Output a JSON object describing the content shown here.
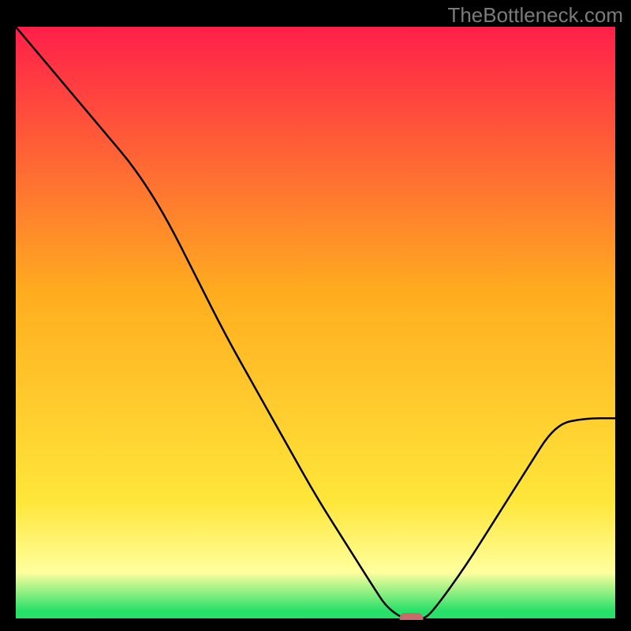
{
  "watermark": "TheBottleneck.com",
  "colors": {
    "black": "#000000",
    "red_top": "#ff1f4a",
    "orange_mid": "#ffad1f",
    "yellow": "#ffe63a",
    "pale_yellow": "#ffff9e",
    "green": "#27e06a",
    "curve": "#000000",
    "marker": "#c96a6a",
    "watermark": "#7b7b7b"
  },
  "chart_data": {
    "type": "line",
    "title": "",
    "xlabel": "",
    "ylabel": "",
    "xlim": [
      0,
      100
    ],
    "ylim": [
      0,
      100
    ],
    "x": [
      0,
      5,
      10,
      15,
      20,
      25,
      30,
      35,
      40,
      45,
      50,
      55,
      60,
      62,
      65,
      68,
      70,
      75,
      80,
      85,
      90,
      95,
      100
    ],
    "values": [
      100,
      94,
      88,
      82,
      76,
      68,
      58,
      48,
      39,
      30,
      21,
      13,
      5,
      2,
      0,
      0,
      2,
      9,
      17,
      25,
      33,
      34,
      34
    ],
    "marker": {
      "x": 66,
      "y": 0
    },
    "gradient_stops": [
      {
        "pos": 0.0,
        "color": "#ff1f4a"
      },
      {
        "pos": 0.45,
        "color": "#ffad1f"
      },
      {
        "pos": 0.8,
        "color": "#ffe63a"
      },
      {
        "pos": 0.92,
        "color": "#ffff9e"
      },
      {
        "pos": 0.985,
        "color": "#27e06a"
      }
    ]
  }
}
